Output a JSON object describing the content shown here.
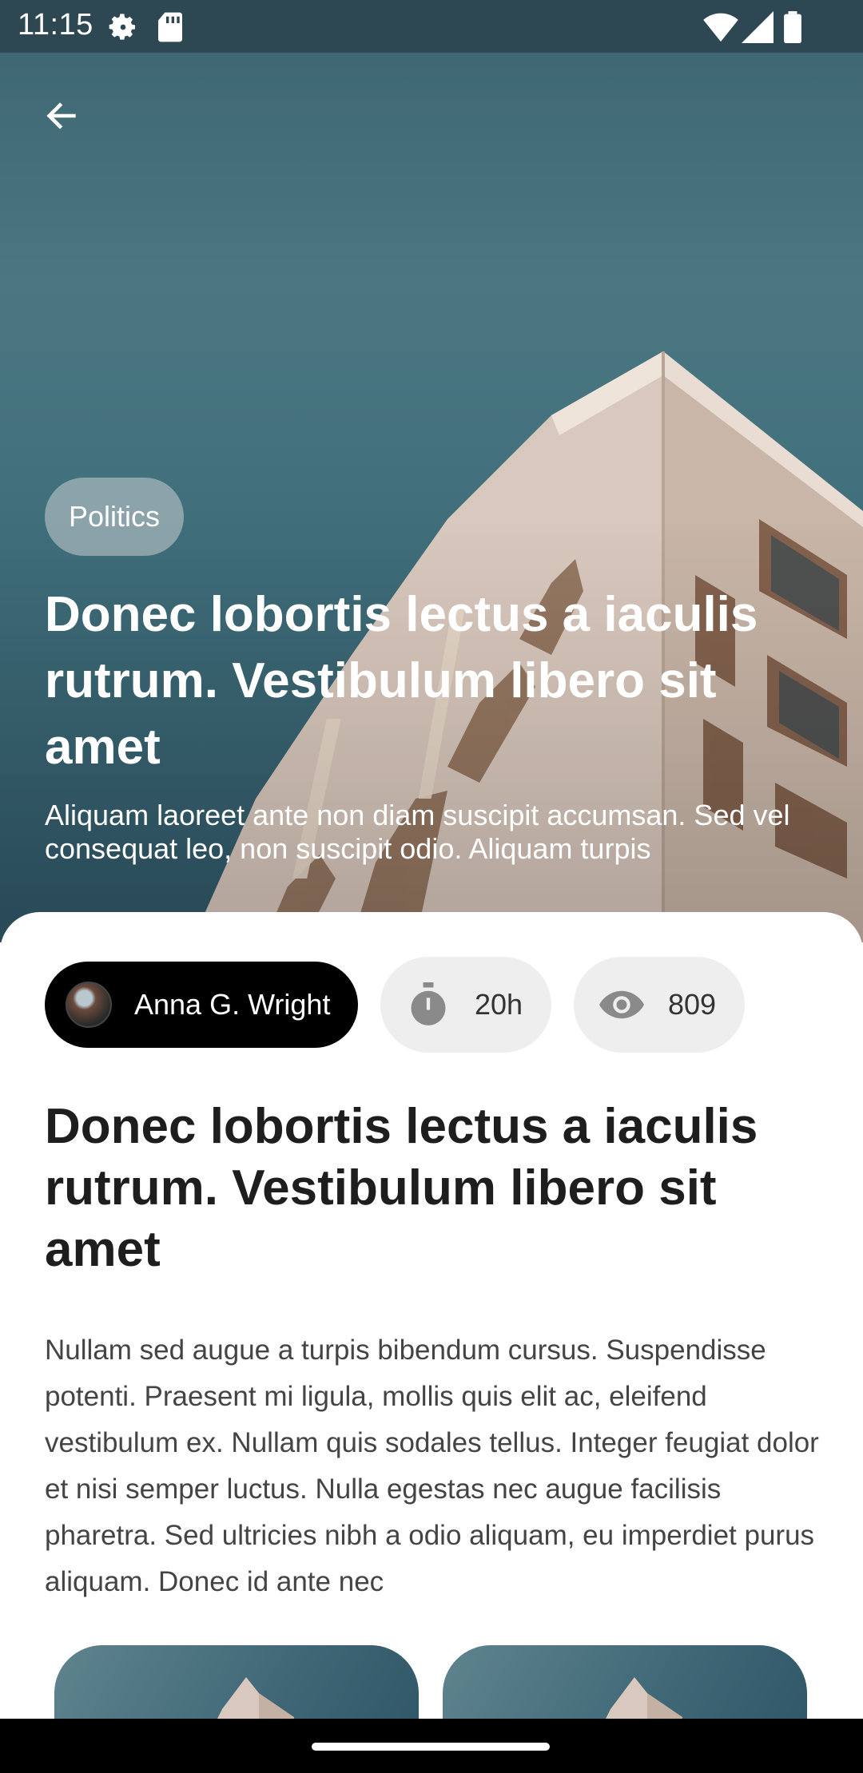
{
  "status_bar": {
    "time": "11:15",
    "icons": [
      "settings-icon",
      "sd-card-icon",
      "wifi-icon",
      "signal-icon",
      "battery-icon"
    ]
  },
  "hero": {
    "category": "Politics",
    "title": "Donec lobortis lectus a iaculis rutrum. Vestibulum libero sit amet",
    "subtitle": "Aliquam laoreet ante non diam suscipit accumsan. Sed vel consequat leo, non suscipit odio. Aliquam turpis"
  },
  "meta": {
    "author": "Anna G. Wright",
    "time_label": "20h",
    "views_label": "809"
  },
  "article": {
    "title": "Donec lobortis lectus a iaculis rutrum. Vestibulum libero sit amet",
    "body": "Nullam sed augue a turpis bibendum cursus. Suspendisse potenti. Praesent mi ligula, mollis quis elit ac, eleifend vestibulum ex. Nullam quis sodales tellus. Integer feugiat dolor et nisi semper luctus. Nulla egestas nec augue facilisis pharetra. Sed ultricies nibh a odio aliquam, eu imperdiet purus aliquam. Donec id ante nec"
  },
  "colors": {
    "sky": "#4b7782",
    "author_chip": "#000000",
    "stat_chip": "#eeeeee"
  }
}
